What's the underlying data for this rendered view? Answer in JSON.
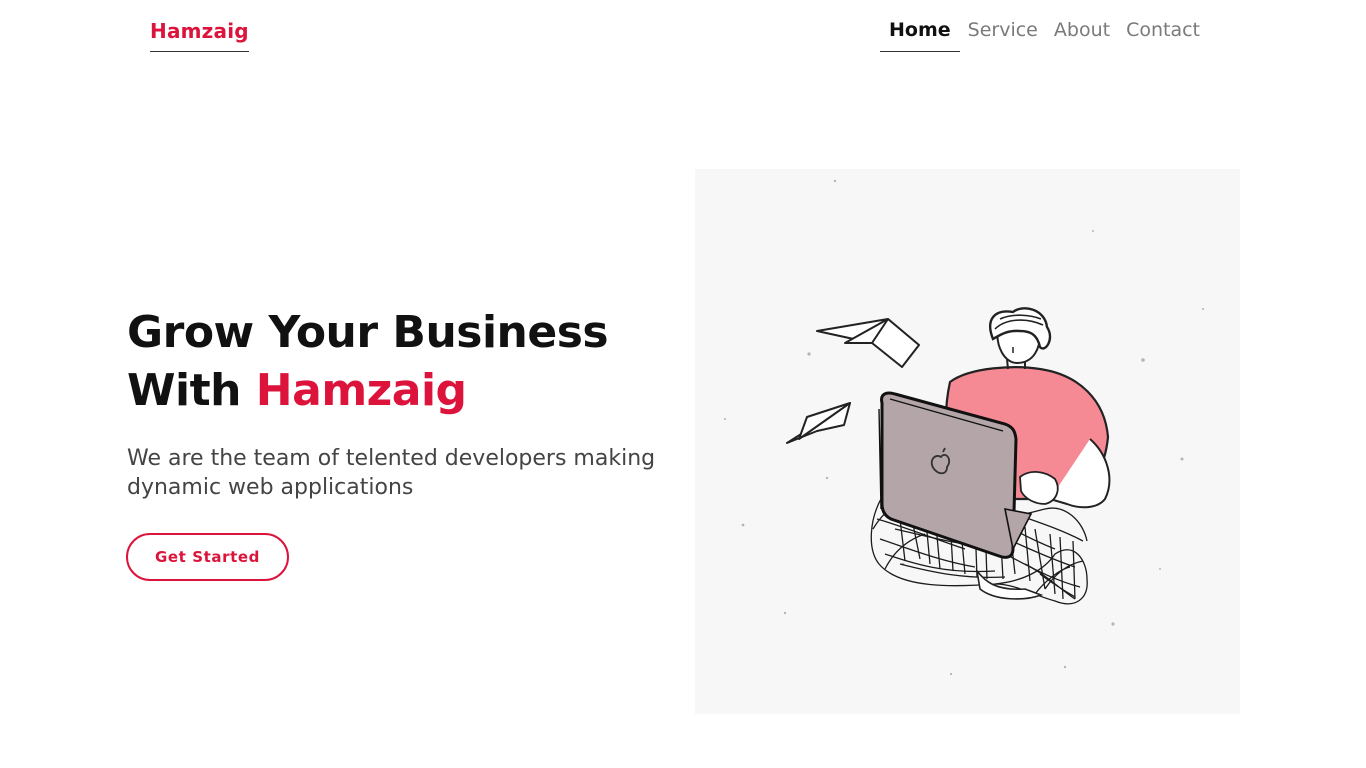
{
  "brand": {
    "name": "Hamzaig",
    "color": "#dc143c"
  },
  "nav": {
    "items": [
      {
        "label": "Home",
        "active": true
      },
      {
        "label": "Service",
        "active": false
      },
      {
        "label": "About",
        "active": false
      },
      {
        "label": "Contact",
        "active": false
      }
    ]
  },
  "hero": {
    "title_line1": "Grow Your Business",
    "title_line2_prefix": "With ",
    "title_line2_accent": "Hamzaig",
    "subtitle": "We are the team of telented developers making dynamic web applications",
    "cta_label": "Get Started",
    "illustration": "person-with-laptop-illustration"
  },
  "colors": {
    "accent": "#dc143c",
    "text": "#111111",
    "muted": "#7a7a7a",
    "shirt": "#f58a95",
    "laptop": "#b3a5a8"
  }
}
